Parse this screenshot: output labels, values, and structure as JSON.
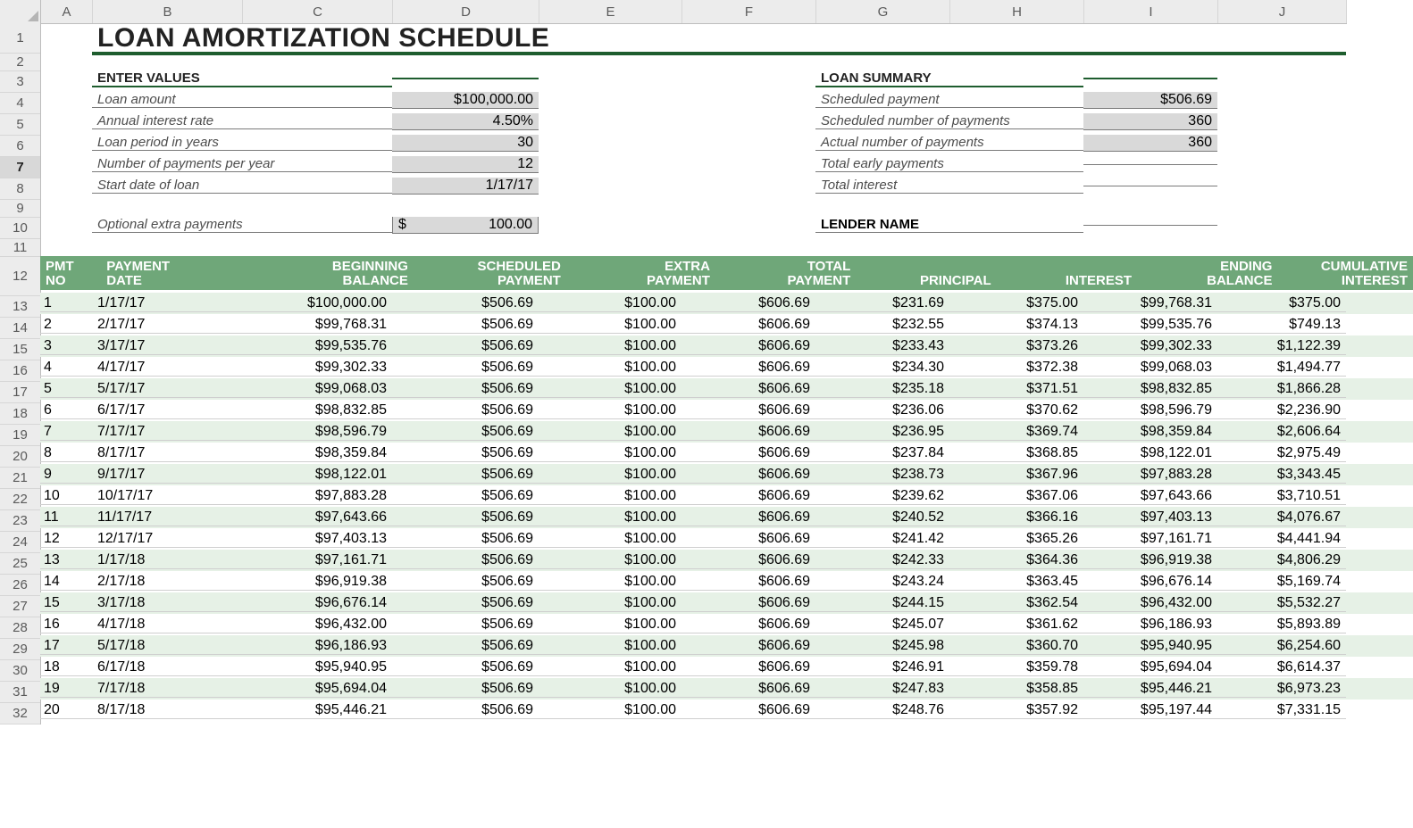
{
  "columns": [
    "A",
    "B",
    "C",
    "D",
    "E",
    "F",
    "G",
    "H",
    "I",
    "J"
  ],
  "colWidths": {
    "A": 58,
    "B": 168,
    "C": 168,
    "D": 164,
    "E": 160,
    "F": 150,
    "G": 150,
    "H": 150,
    "I": 150,
    "J": 144
  },
  "rowHeaders": [
    1,
    2,
    3,
    4,
    5,
    6,
    7,
    8,
    9,
    10,
    11,
    12,
    13,
    14,
    15,
    16,
    17,
    18,
    19,
    20,
    21,
    22,
    23,
    24,
    25,
    26,
    27,
    28,
    29,
    30,
    31,
    32
  ],
  "rowHeights": {
    "1": 34,
    "2": 20,
    "3": 24,
    "4": 24,
    "5": 24,
    "6": 24,
    "7": 24,
    "8": 24,
    "9": 20,
    "10": 24,
    "11": 20,
    "12": 44,
    "13": 24,
    "14": 24,
    "15": 24,
    "16": 24,
    "17": 24,
    "18": 24,
    "19": 24,
    "20": 24,
    "21": 24,
    "22": 24,
    "23": 24,
    "24": 24,
    "25": 24,
    "26": 24,
    "27": 24,
    "28": 24,
    "29": 24,
    "30": 24,
    "31": 24,
    "32": 24
  },
  "selectedRow": 7,
  "title": "LOAN AMORTIZATION SCHEDULE",
  "sections": {
    "enter": "ENTER VALUES",
    "summary": "LOAN SUMMARY",
    "lender": "LENDER NAME"
  },
  "inputs": {
    "rows": [
      {
        "label": "Loan amount",
        "value": "$100,000.00"
      },
      {
        "label": "Annual interest rate",
        "value": "4.50%"
      },
      {
        "label": "Loan period in years",
        "value": "30"
      },
      {
        "label": "Number of payments per year",
        "value": "12"
      },
      {
        "label": "Start date of loan",
        "value": "1/17/17"
      }
    ],
    "extra": {
      "label": "Optional extra payments",
      "prefix": "$",
      "value": "100.00"
    }
  },
  "summary": {
    "rows": [
      {
        "label": "Scheduled payment",
        "value": "$506.69"
      },
      {
        "label": "Scheduled number of payments",
        "value": "360"
      },
      {
        "label": "Actual number of payments",
        "value": "360"
      },
      {
        "label": "Total early payments",
        "value": ""
      },
      {
        "label": "Total interest",
        "value": ""
      }
    ]
  },
  "tableHeaders": [
    {
      "l1": "PMT",
      "l2": "NO",
      "align": "al",
      "w": "wA"
    },
    {
      "l1": "PAYMENT",
      "l2": "DATE",
      "align": "al",
      "w": "wB"
    },
    {
      "l1": "BEGINNING",
      "l2": "BALANCE",
      "align": "ar",
      "w": "wC"
    },
    {
      "l1": "SCHEDULED",
      "l2": "PAYMENT",
      "align": "ar",
      "w": "wD"
    },
    {
      "l1": "EXTRA",
      "l2": "PAYMENT",
      "align": "ar",
      "w": "wE"
    },
    {
      "l1": "TOTAL",
      "l2": "PAYMENT",
      "align": "ar",
      "w": "wF"
    },
    {
      "l1": "",
      "l2": "PRINCIPAL",
      "align": "ar",
      "w": "wG"
    },
    {
      "l1": "",
      "l2": "INTEREST",
      "align": "ar",
      "w": "wH"
    },
    {
      "l1": "ENDING",
      "l2": "BALANCE",
      "align": "ar",
      "w": "wI"
    },
    {
      "l1": "CUMULATIVE",
      "l2": "INTEREST",
      "align": "ar",
      "w": "wJ"
    }
  ],
  "chart_data": {
    "type": "table",
    "title": "Loan Amortization Schedule",
    "columns": [
      "PMT NO",
      "PAYMENT DATE",
      "BEGINNING BALANCE",
      "SCHEDULED PAYMENT",
      "EXTRA PAYMENT",
      "TOTAL PAYMENT",
      "PRINCIPAL",
      "INTEREST",
      "ENDING BALANCE",
      "CUMULATIVE INTEREST"
    ],
    "rows": [
      [
        "1",
        "1/17/17",
        "$100,000.00",
        "$506.69",
        "$100.00",
        "$606.69",
        "$231.69",
        "$375.00",
        "$99,768.31",
        "$375.00"
      ],
      [
        "2",
        "2/17/17",
        "$99,768.31",
        "$506.69",
        "$100.00",
        "$606.69",
        "$232.55",
        "$374.13",
        "$99,535.76",
        "$749.13"
      ],
      [
        "3",
        "3/17/17",
        "$99,535.76",
        "$506.69",
        "$100.00",
        "$606.69",
        "$233.43",
        "$373.26",
        "$99,302.33",
        "$1,122.39"
      ],
      [
        "4",
        "4/17/17",
        "$99,302.33",
        "$506.69",
        "$100.00",
        "$606.69",
        "$234.30",
        "$372.38",
        "$99,068.03",
        "$1,494.77"
      ],
      [
        "5",
        "5/17/17",
        "$99,068.03",
        "$506.69",
        "$100.00",
        "$606.69",
        "$235.18",
        "$371.51",
        "$98,832.85",
        "$1,866.28"
      ],
      [
        "6",
        "6/17/17",
        "$98,832.85",
        "$506.69",
        "$100.00",
        "$606.69",
        "$236.06",
        "$370.62",
        "$98,596.79",
        "$2,236.90"
      ],
      [
        "7",
        "7/17/17",
        "$98,596.79",
        "$506.69",
        "$100.00",
        "$606.69",
        "$236.95",
        "$369.74",
        "$98,359.84",
        "$2,606.64"
      ],
      [
        "8",
        "8/17/17",
        "$98,359.84",
        "$506.69",
        "$100.00",
        "$606.69",
        "$237.84",
        "$368.85",
        "$98,122.01",
        "$2,975.49"
      ],
      [
        "9",
        "9/17/17",
        "$98,122.01",
        "$506.69",
        "$100.00",
        "$606.69",
        "$238.73",
        "$367.96",
        "$97,883.28",
        "$3,343.45"
      ],
      [
        "10",
        "10/17/17",
        "$97,883.28",
        "$506.69",
        "$100.00",
        "$606.69",
        "$239.62",
        "$367.06",
        "$97,643.66",
        "$3,710.51"
      ],
      [
        "11",
        "11/17/17",
        "$97,643.66",
        "$506.69",
        "$100.00",
        "$606.69",
        "$240.52",
        "$366.16",
        "$97,403.13",
        "$4,076.67"
      ],
      [
        "12",
        "12/17/17",
        "$97,403.13",
        "$506.69",
        "$100.00",
        "$606.69",
        "$241.42",
        "$365.26",
        "$97,161.71",
        "$4,441.94"
      ],
      [
        "13",
        "1/17/18",
        "$97,161.71",
        "$506.69",
        "$100.00",
        "$606.69",
        "$242.33",
        "$364.36",
        "$96,919.38",
        "$4,806.29"
      ],
      [
        "14",
        "2/17/18",
        "$96,919.38",
        "$506.69",
        "$100.00",
        "$606.69",
        "$243.24",
        "$363.45",
        "$96,676.14",
        "$5,169.74"
      ],
      [
        "15",
        "3/17/18",
        "$96,676.14",
        "$506.69",
        "$100.00",
        "$606.69",
        "$244.15",
        "$362.54",
        "$96,432.00",
        "$5,532.27"
      ],
      [
        "16",
        "4/17/18",
        "$96,432.00",
        "$506.69",
        "$100.00",
        "$606.69",
        "$245.07",
        "$361.62",
        "$96,186.93",
        "$5,893.89"
      ],
      [
        "17",
        "5/17/18",
        "$96,186.93",
        "$506.69",
        "$100.00",
        "$606.69",
        "$245.98",
        "$360.70",
        "$95,940.95",
        "$6,254.60"
      ],
      [
        "18",
        "6/17/18",
        "$95,940.95",
        "$506.69",
        "$100.00",
        "$606.69",
        "$246.91",
        "$359.78",
        "$95,694.04",
        "$6,614.37"
      ],
      [
        "19",
        "7/17/18",
        "$95,694.04",
        "$506.69",
        "$100.00",
        "$606.69",
        "$247.83",
        "$358.85",
        "$95,446.21",
        "$6,973.23"
      ],
      [
        "20",
        "8/17/18",
        "$95,446.21",
        "$506.69",
        "$100.00",
        "$606.69",
        "$248.76",
        "$357.92",
        "$95,197.44",
        "$7,331.15"
      ]
    ]
  }
}
